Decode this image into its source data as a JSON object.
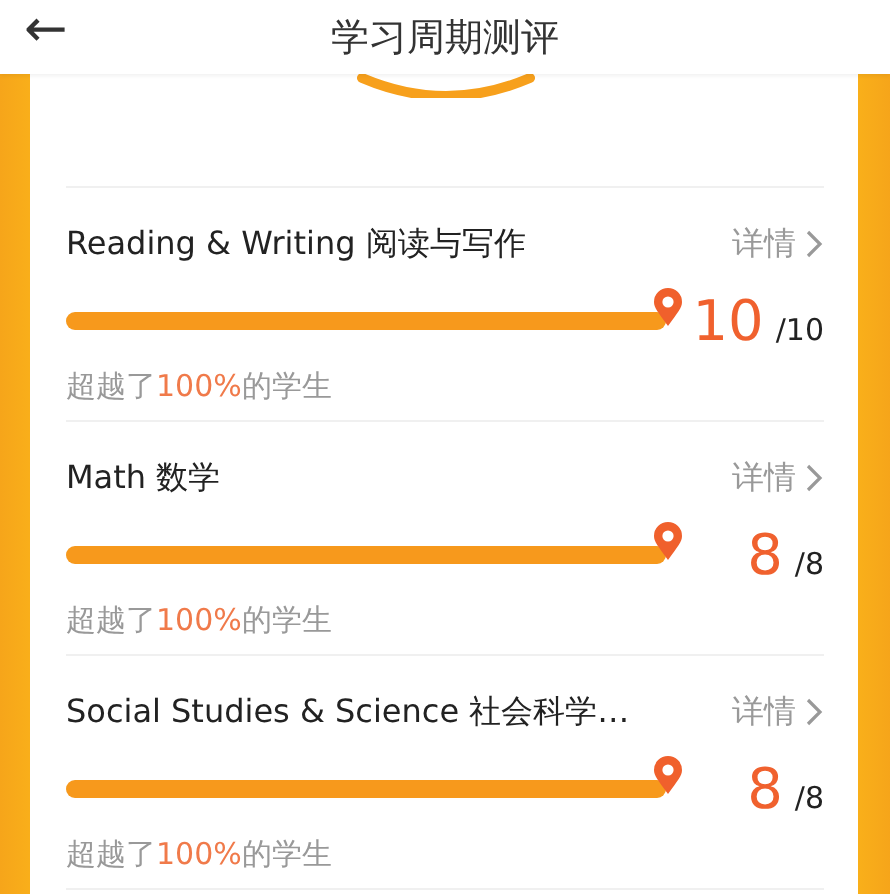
{
  "header": {
    "back_icon": "←",
    "title": "学习周期测评"
  },
  "subjects": [
    {
      "name": "Reading & Writing 阅读与写作",
      "details": "详情",
      "level": 1,
      "score": "10",
      "total": "/10",
      "beat_prefix": "超越了",
      "beat_percent": "100%",
      "beat_suffix": "的学生"
    },
    {
      "name": "Math 数学",
      "details": "详情",
      "level": 1,
      "score": "8",
      "total": "/8",
      "beat_prefix": "超越了",
      "beat_percent": "100%",
      "beat_suffix": "的学生"
    },
    {
      "name": "Social Studies & Science 社会科学…",
      "details": "详情",
      "level": 1,
      "score": "8",
      "total": "/8",
      "beat_prefix": "超越了",
      "beat_percent": "100%",
      "beat_suffix": "的学生"
    }
  ]
}
